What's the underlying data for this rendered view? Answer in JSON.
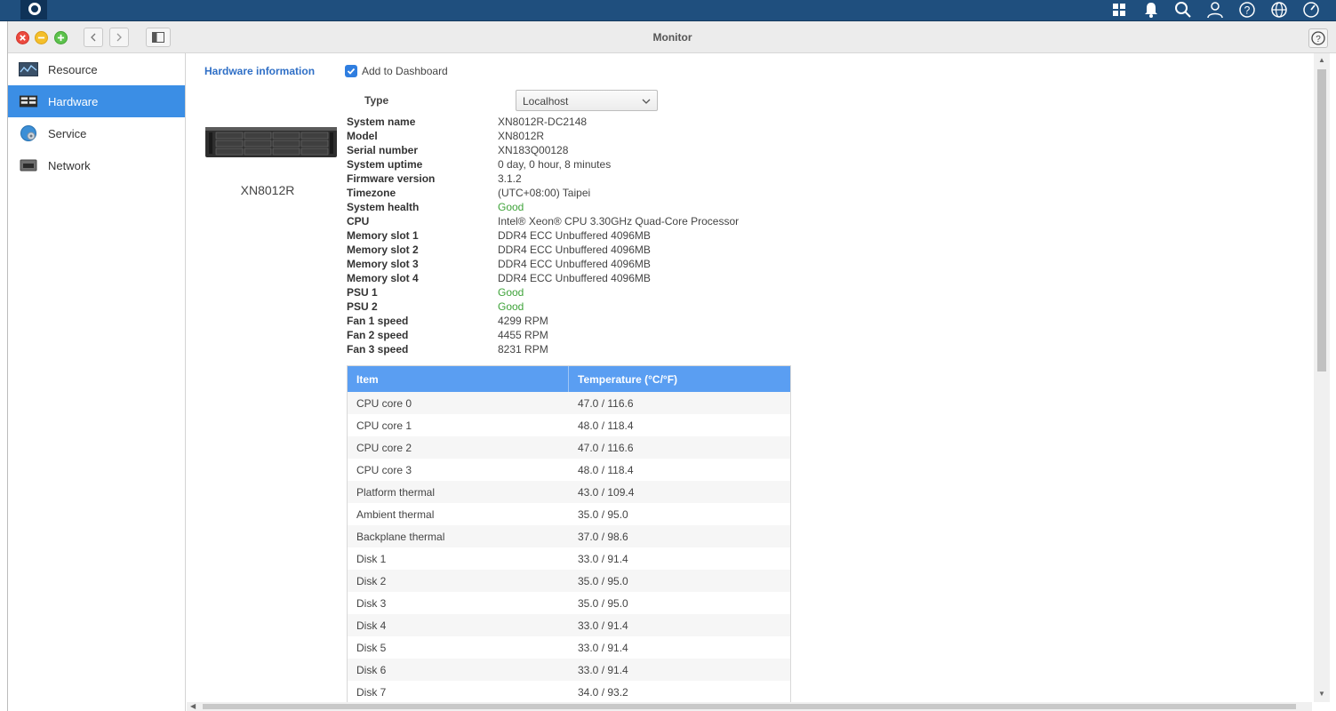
{
  "window": {
    "title": "Monitor"
  },
  "sidebar": {
    "items": [
      {
        "label": "Resource",
        "icon": "resource-icon",
        "active": false
      },
      {
        "label": "Hardware",
        "icon": "hardware-icon",
        "active": true
      },
      {
        "label": "Service",
        "icon": "service-icon",
        "active": false
      },
      {
        "label": "Network",
        "icon": "network-icon",
        "active": false
      }
    ]
  },
  "main": {
    "title": "Hardware information",
    "add_to_dashboard": {
      "label": "Add to Dashboard",
      "checked": true
    },
    "type": {
      "label": "Type",
      "value": "Localhost"
    },
    "device": {
      "name": "XN8012R"
    },
    "info": [
      {
        "key": "System name",
        "value": "XN8012R-DC2148"
      },
      {
        "key": "Model",
        "value": "XN8012R"
      },
      {
        "key": "Serial number",
        "value": "XN183Q00128"
      },
      {
        "key": "System uptime",
        "value": "0 day, 0 hour, 8 minutes"
      },
      {
        "key": "Firmware version",
        "value": "3.1.2"
      },
      {
        "key": "Timezone",
        "value": "(UTC+08:00) Taipei"
      },
      {
        "key": "System health",
        "value": "Good"
      },
      {
        "key": "CPU",
        "value": "Intel® Xeon® CPU 3.30GHz Quad-Core Processor"
      },
      {
        "key": "Memory slot 1",
        "value": "DDR4 ECC Unbuffered 4096MB"
      },
      {
        "key": "Memory slot 2",
        "value": "DDR4 ECC Unbuffered 4096MB"
      },
      {
        "key": "Memory slot 3",
        "value": "DDR4 ECC Unbuffered 4096MB"
      },
      {
        "key": "Memory slot 4",
        "value": "DDR4 ECC Unbuffered 4096MB"
      },
      {
        "key": "PSU 1",
        "value": "Good"
      },
      {
        "key": "PSU 2",
        "value": "Good"
      },
      {
        "key": "Fan 1 speed",
        "value": "4299 RPM"
      },
      {
        "key": "Fan 2 speed",
        "value": "4455 RPM"
      },
      {
        "key": "Fan 3 speed",
        "value": "8231 RPM"
      }
    ],
    "temperature_table": {
      "headers": [
        "Item",
        "Temperature (°C/°F)"
      ],
      "rows": [
        [
          "CPU core 0",
          "47.0 / 116.6"
        ],
        [
          "CPU core 1",
          "48.0 / 118.4"
        ],
        [
          "CPU core 2",
          "47.0 / 116.6"
        ],
        [
          "CPU core 3",
          "48.0 / 118.4"
        ],
        [
          "Platform thermal",
          "43.0 / 109.4"
        ],
        [
          "Ambient thermal",
          "35.0 / 95.0"
        ],
        [
          "Backplane thermal",
          "37.0 / 98.6"
        ],
        [
          "Disk 1",
          "33.0 / 91.4"
        ],
        [
          "Disk 2",
          "35.0 / 95.0"
        ],
        [
          "Disk 3",
          "35.0 / 95.0"
        ],
        [
          "Disk 4",
          "33.0 / 91.4"
        ],
        [
          "Disk 5",
          "33.0 / 91.4"
        ],
        [
          "Disk 6",
          "33.0 / 91.4"
        ],
        [
          "Disk 7",
          "34.0 / 93.2"
        ]
      ]
    }
  },
  "colors": {
    "accent": "#3b8ee5",
    "header_bar": "#1f4f7e",
    "good": "#3fa33a",
    "table_header": "#5a9ef2"
  }
}
